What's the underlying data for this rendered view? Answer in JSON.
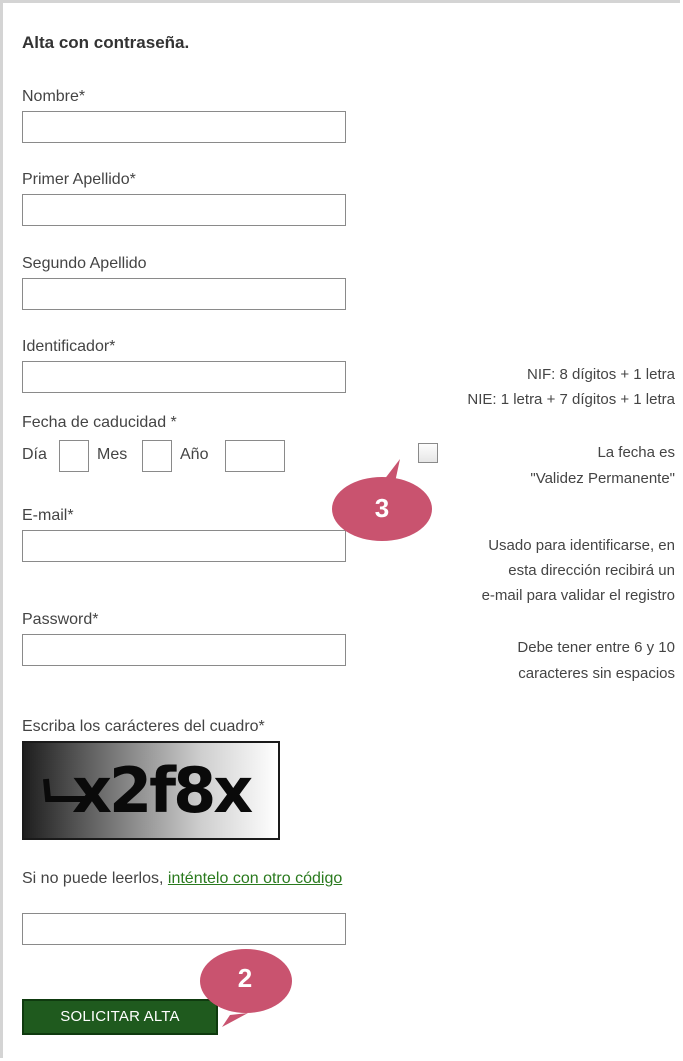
{
  "form": {
    "title": "Alta con contraseña.",
    "nombre": {
      "label": "Nombre*",
      "value": ""
    },
    "primer_apellido": {
      "label": "Primer Apellido*",
      "value": ""
    },
    "segundo_apellido": {
      "label": "Segundo Apellido",
      "value": ""
    },
    "identificador": {
      "label": "Identificador*",
      "value": "",
      "help_line1": "NIF: 8 dígitos + 1 letra",
      "help_line2": "NIE: 1 letra + 7 dígitos + 1 letra"
    },
    "fecha_caducidad": {
      "label": "Fecha de caducidad *",
      "dia_label": "Día",
      "mes_label": "Mes",
      "anio_label": "Año",
      "dia_value": "",
      "mes_value": "",
      "anio_value": "",
      "permanente_checked": false,
      "permanente_line1": "La fecha es",
      "permanente_line2": "\"Validez Permanente\""
    },
    "email": {
      "label": "E-mail*",
      "value": "",
      "help_line1": "Usado para identificarse, en",
      "help_line2": "esta dirección recibirá un",
      "help_line3": "e-mail para validar el registro"
    },
    "password": {
      "label": "Password*",
      "value": "",
      "help_line1": "Debe tener entre 6 y 10",
      "help_line2": "caracteres sin espacios"
    },
    "captcha": {
      "label": "Escriba los carácteres del cuadro*",
      "image_text": "x2f8x",
      "retry_prefix": "Si no puede leerlos,",
      "retry_link": "inténtelo con otro código",
      "value": ""
    },
    "submit_label": "SOLICITAR ALTA"
  },
  "callouts": [
    {
      "number": "3",
      "color": "#c9536f"
    },
    {
      "number": "2",
      "color": "#c9536f"
    }
  ],
  "colors": {
    "submit_bg": "#1f5a1e",
    "link": "#2a7a1e",
    "callout": "#c9536f"
  }
}
